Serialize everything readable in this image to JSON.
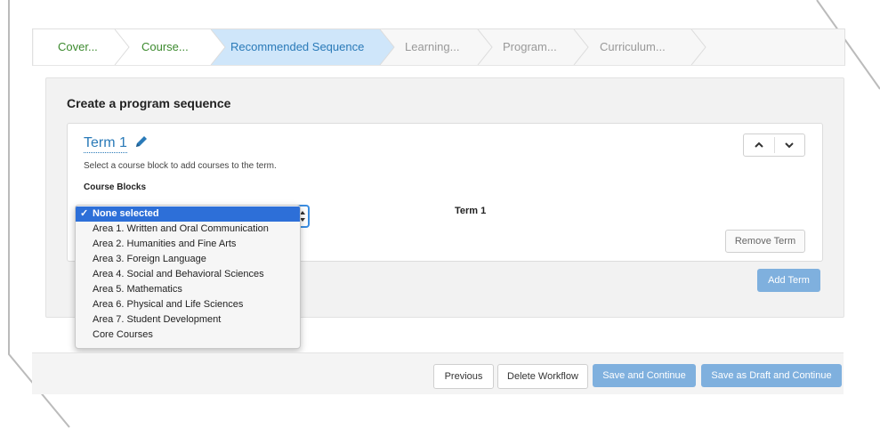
{
  "steps": [
    {
      "label": "Cover..."
    },
    {
      "label": "Course..."
    },
    {
      "label": "Recommended Sequence"
    },
    {
      "label": "Learning..."
    },
    {
      "label": "Program..."
    },
    {
      "label": "Curriculum..."
    }
  ],
  "panel": {
    "title": "Create a program sequence",
    "term": {
      "title": "Term 1",
      "hint": "Select a course block to add courses to the term.",
      "blocks_label": "Course Blocks",
      "column_label": "Term 1",
      "remove_label": "Remove Term"
    },
    "add_term_label": "Add Term"
  },
  "dropdown": {
    "items": [
      "None selected",
      "Area 1. Written and Oral Communication",
      "Area 2. Humanities and Fine Arts",
      "Area 3. Foreign Language",
      "Area 4. Social and Behavioral Sciences",
      "Area 5. Mathematics",
      "Area 6. Physical and Life Sciences",
      "Area 7. Student Development",
      "Core Courses"
    ],
    "selected": "None selected"
  },
  "footer": {
    "previous": "Previous",
    "delete": "Delete Workflow",
    "save_continue": "Save and Continue",
    "save_draft": "Save as Draft and Continue"
  },
  "colors": {
    "active_step": "#cfe6fa",
    "completed_step_text": "#3c8a2e",
    "primary_button": "#7fb0de",
    "link": "#2a7ab8",
    "selected_option": "#2d6fd8"
  }
}
